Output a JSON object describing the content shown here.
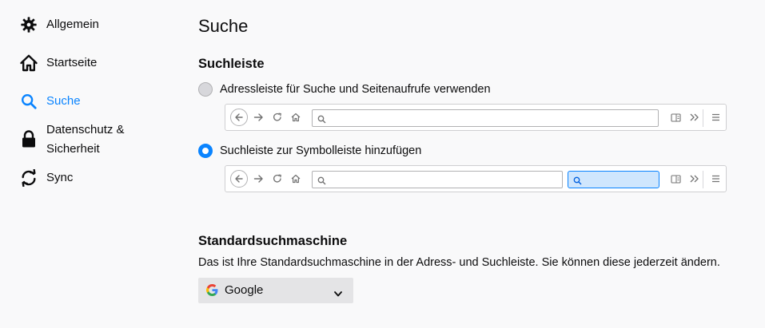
{
  "sidebar": {
    "items": [
      {
        "label": "Allgemein",
        "icon": "gear-icon"
      },
      {
        "label": "Startseite",
        "icon": "home-icon"
      },
      {
        "label": "Suche",
        "icon": "search-icon",
        "selected": true
      },
      {
        "label_line1": "Datenschutz &",
        "label_line2": "Sicherheit",
        "icon": "lock-icon"
      },
      {
        "label": "Sync",
        "icon": "sync-icon"
      }
    ]
  },
  "main": {
    "title": "Suche",
    "searchbar_section": {
      "heading": "Suchleiste",
      "option_address": "Adressleiste für Suche und Seitenaufrufe verwenden",
      "option_toolbar": "Suchleiste zur Symbolleiste hinzufügen",
      "selected": "option_toolbar"
    },
    "default_engine_section": {
      "heading": "Standardsuchmaschine",
      "description": "Das ist Ihre Standardsuchmaschine in der Adress- und Suchleiste. Sie können diese jederzeit ändern.",
      "selected_engine": "Google"
    }
  },
  "colors": {
    "accent": "#0a84ff",
    "text": "#0c0c0d",
    "background": "#f9f9fa"
  }
}
